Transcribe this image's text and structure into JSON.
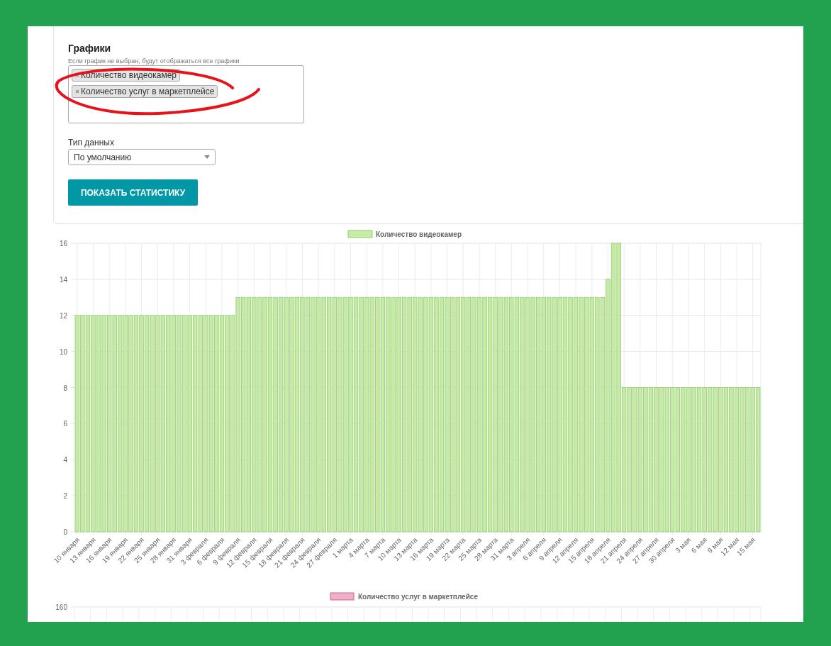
{
  "filters": {
    "title": "Графики",
    "hint": "Если график не выбран, будут отображаться все графики",
    "tags": [
      "Количество видеокамер",
      "Количество услуг в маркетплейсе"
    ],
    "data_type": {
      "label": "Тип данных",
      "value": "По умолчанию"
    },
    "submit": "ПОКАЗАТЬ СТАТИСТИКУ"
  },
  "charts": [
    {
      "chart_data": {
        "type": "bar",
        "grid": true,
        "ylim": [
          0,
          16
        ],
        "yticks": [
          0,
          2,
          4,
          6,
          8,
          10,
          12,
          14,
          16
        ],
        "categories": [
          "10 января",
          null,
          null,
          "13 января",
          null,
          null,
          "16 января",
          null,
          null,
          "19 января",
          null,
          null,
          "22 января",
          null,
          null,
          "25 января",
          null,
          null,
          "28 января",
          null,
          null,
          "31 января",
          null,
          null,
          "3 февраля",
          null,
          null,
          "6 февраля",
          null,
          null,
          "9 февраля",
          null,
          null,
          "12 февраля",
          null,
          null,
          "15 февраля",
          null,
          null,
          "18 февраля",
          null,
          null,
          "21 февраля",
          null,
          null,
          "24 февраля",
          null,
          null,
          "27 февраля",
          null,
          null,
          "1 марта",
          null,
          null,
          "4 марта",
          null,
          null,
          "7 марта",
          null,
          null,
          "10 марта",
          null,
          null,
          "13 марта",
          null,
          null,
          "16 марта",
          null,
          null,
          "19 марта",
          null,
          null,
          "22 марта",
          null,
          null,
          "25 марта",
          null,
          null,
          "28 марта",
          null,
          null,
          "31 марта",
          null,
          null,
          "3 апреля",
          null,
          null,
          "6 апреля",
          null,
          null,
          "9 апреля",
          null,
          null,
          "12 апреля",
          null,
          null,
          "15 апреля",
          null,
          null,
          "18 апреля",
          null,
          null,
          "21 апреля",
          null,
          null,
          "24 апреля",
          null,
          null,
          "27 апреля",
          null,
          null,
          "30 апреля",
          null,
          null,
          "3 мая",
          null,
          null,
          "6 мая",
          null,
          null,
          "9 мая",
          null,
          null,
          "12 мая",
          null,
          null,
          "15 мая",
          null
        ],
        "series": [
          {
            "name": "Количество видеокамер",
            "color": "#c8e9a8",
            "values": [
              12,
              12,
              12,
              12,
              12,
              12,
              12,
              12,
              12,
              12,
              12,
              12,
              12,
              12,
              12,
              12,
              12,
              12,
              12,
              12,
              12,
              12,
              12,
              12,
              12,
              12,
              12,
              12,
              12,
              12,
              13,
              13,
              13,
              13,
              13,
              13,
              13,
              13,
              13,
              13,
              13,
              13,
              13,
              13,
              13,
              13,
              13,
              13,
              13,
              13,
              13,
              13,
              13,
              13,
              13,
              13,
              13,
              13,
              13,
              13,
              13,
              13,
              13,
              13,
              13,
              13,
              13,
              13,
              13,
              13,
              13,
              13,
              13,
              13,
              13,
              13,
              13,
              13,
              13,
              13,
              13,
              13,
              13,
              13,
              13,
              13,
              13,
              13,
              13,
              13,
              13,
              13,
              13,
              13,
              13,
              13,
              13,
              13,
              13,
              14,
              16,
              16,
              8,
              8,
              8,
              8,
              8,
              8,
              8,
              8,
              8,
              8,
              8,
              8,
              8,
              8,
              8,
              8,
              8,
              8,
              8,
              8,
              8,
              8,
              8,
              8,
              8,
              8
            ]
          }
        ]
      }
    },
    {
      "legend": {
        "name": "Количество услуг в маркетплейсе",
        "color": "#edaec8"
      },
      "top_tick": "160"
    }
  ]
}
